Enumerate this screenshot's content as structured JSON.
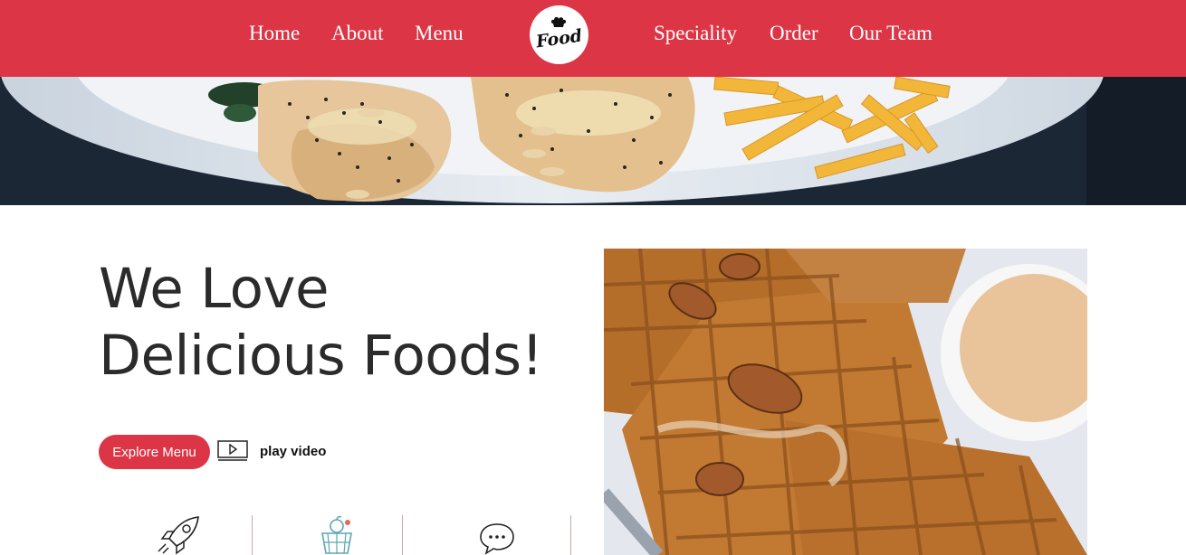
{
  "header": {
    "nav_left": [
      "Home",
      "About",
      "Menu"
    ],
    "nav_right": [
      "Speciality",
      "Order",
      "Our Team"
    ],
    "logo_text": "Food",
    "background_color": "#dc3545"
  },
  "hero": {
    "headline_line1": "We Love",
    "headline_line2": "Delicious Foods!",
    "explore_button": "Explore Menu",
    "play_label": "play video"
  },
  "features": {
    "icons": [
      "rocket-icon",
      "fruit-basket-icon",
      "chat-bubble-icon"
    ]
  },
  "images": {
    "banner": "plated chicken with poppy seeds and fries",
    "photo": "waffles with pecans and dipping sauce"
  }
}
